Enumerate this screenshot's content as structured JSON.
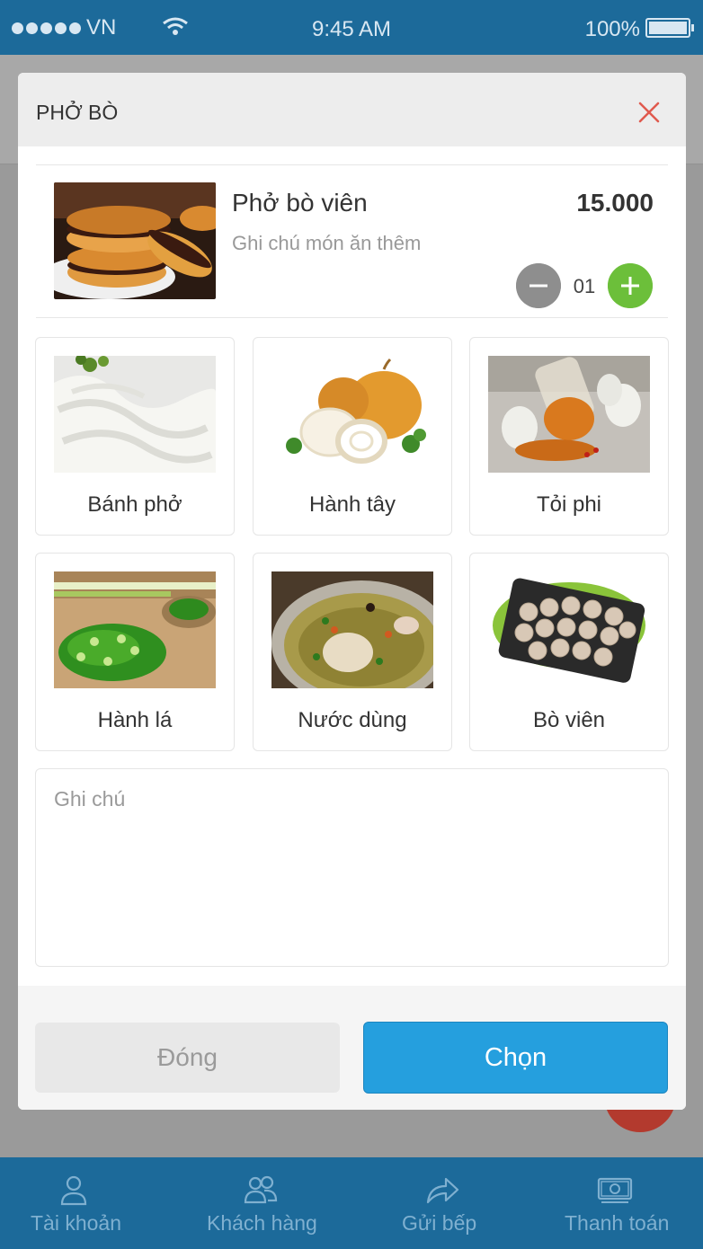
{
  "status_bar": {
    "carrier": "VN",
    "time": "9:45 AM",
    "battery": "100%"
  },
  "modal": {
    "title": "PHỞ BÒ",
    "item": {
      "name": "Phở bò viên",
      "note": "Ghi chú món ăn thêm",
      "price": "15.000",
      "quantity": "01"
    },
    "toppings": [
      {
        "label": "Bánh phở"
      },
      {
        "label": "Hành tây"
      },
      {
        "label": "Tỏi phi"
      },
      {
        "label": "Hành lá"
      },
      {
        "label": "Nước dùng"
      },
      {
        "label": "Bò viên"
      }
    ],
    "note_placeholder": "Ghi chú",
    "close_label": "Đóng",
    "choose_label": "Chọn"
  },
  "bottom_nav": [
    {
      "label": "Tài khoản",
      "icon": "user-icon"
    },
    {
      "label": "Khách hàng",
      "icon": "users-icon"
    },
    {
      "label": "Gửi bếp",
      "icon": "share-arrow-icon"
    },
    {
      "label": "Thanh toán",
      "icon": "money-icon"
    }
  ],
  "colors": {
    "primary": "#259fde",
    "nav_bg": "#1c6a9a",
    "plus": "#6cbf3a",
    "close_x": "#e05a4e"
  }
}
